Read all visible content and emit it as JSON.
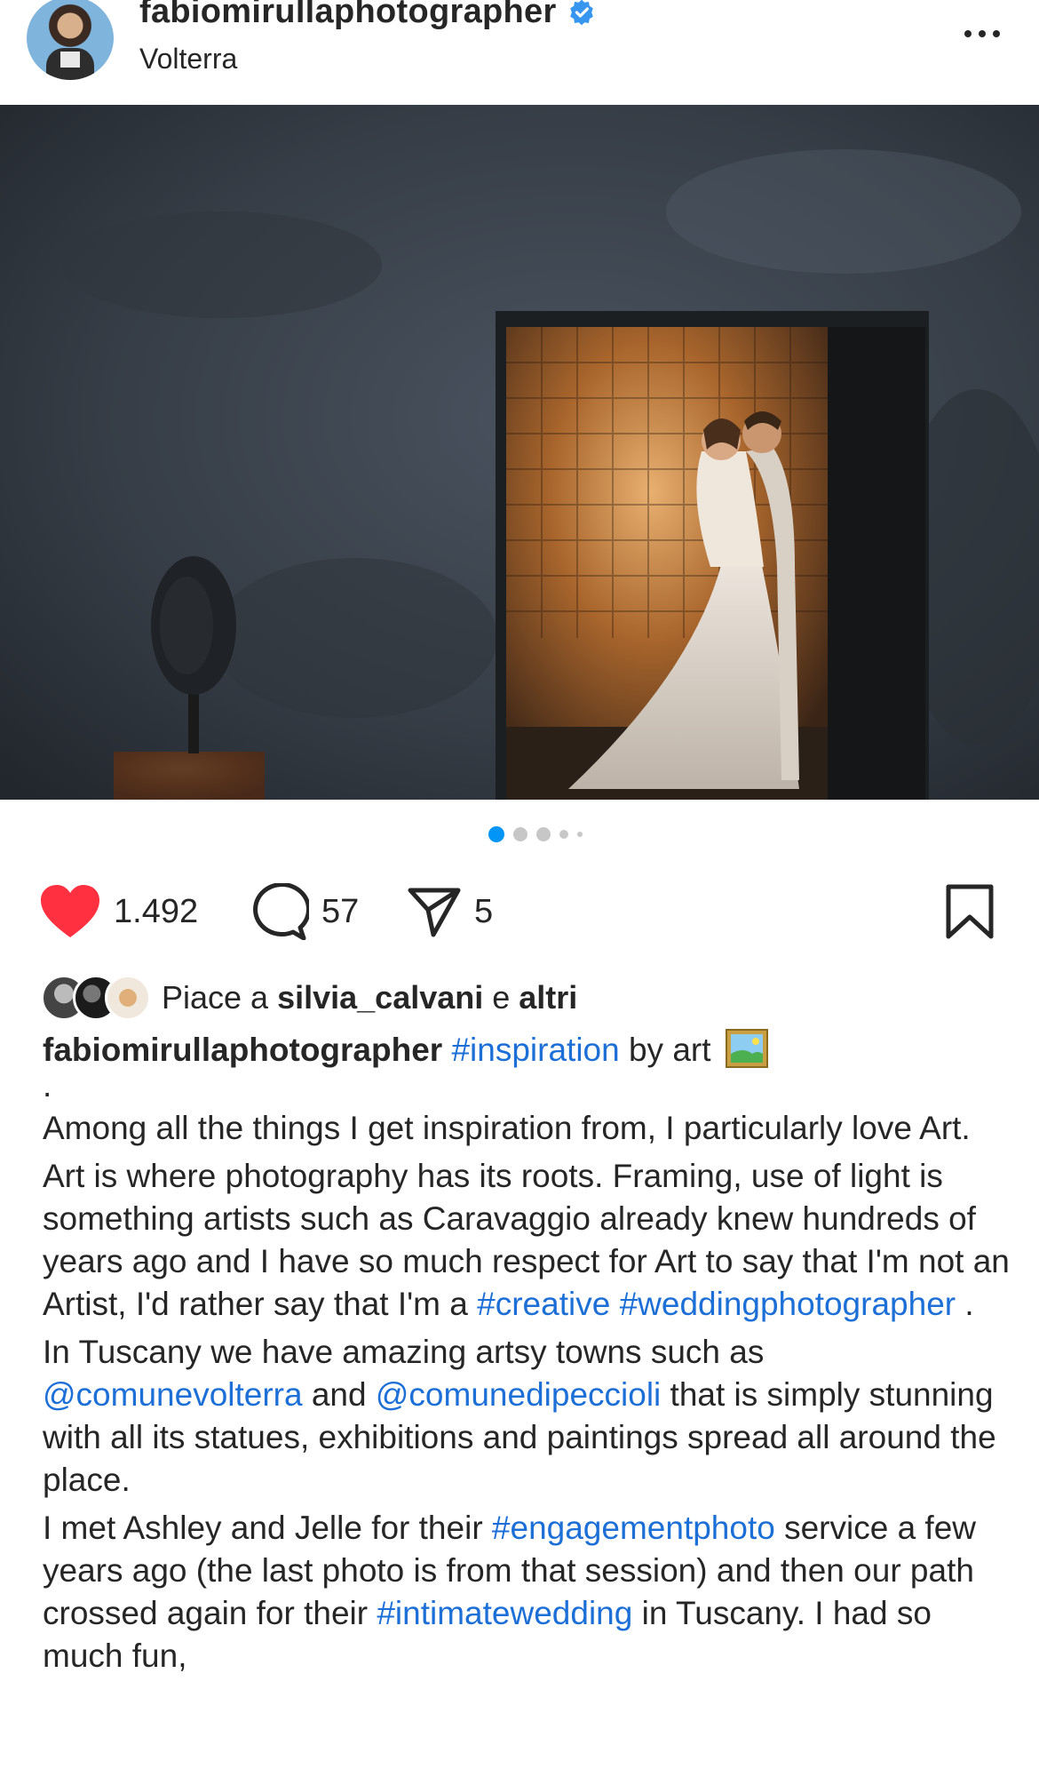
{
  "post": {
    "username": "fabiomirullaphotographer",
    "location": "Volterra",
    "verified_color": "#3797f0"
  },
  "carousel": {
    "slides": 5,
    "active_index": 0,
    "active_color": "#0095f6"
  },
  "actions": {
    "like_count": "1.492",
    "comment_count": "57",
    "share_count": "5",
    "like_color": "#ff3040"
  },
  "likes": {
    "prefix": "Piace a ",
    "user": "silvia_calvani",
    "middle": " e ",
    "others": "altri"
  },
  "caption": {
    "username": "fabiomirullaphotographer",
    "line1_tag": "#inspiration",
    "line1_rest": " by art",
    "line1_emoji": "framed-picture-emoji",
    "dot": ".",
    "p1": "Among all the things I get inspiration from, I particularly love Art.",
    "p2_a": "Art is where photography has its roots. Framing, use of light is something artists such as Caravaggio already knew hundreds of years ago and I have so much respect for Art to say that I'm not an Artist, I'd rather say that I'm a ",
    "p2_tag1": "#creative",
    "p2_tag2": "#weddingphotographer",
    "p2_end": " .",
    "p3_a": "In Tuscany we have amazing artsy towns such as ",
    "p3_mention1": "@comunevolterra",
    "p3_b": " and ",
    "p3_mention2": "@comunedipeccioli",
    "p3_c": " that is simply stunning with all its statues, exhibitions and paintings spread all around the place.",
    "p4_a": "I met Ashley and Jelle for their ",
    "p4_tag1": "#engagementphoto",
    "p4_b": " service a few years ago (the last photo is from that session) and then our path crossed again for their ",
    "p4_tag2": "#intimatewedding",
    "p4_c": " in Tuscany. I had so much fun,"
  }
}
